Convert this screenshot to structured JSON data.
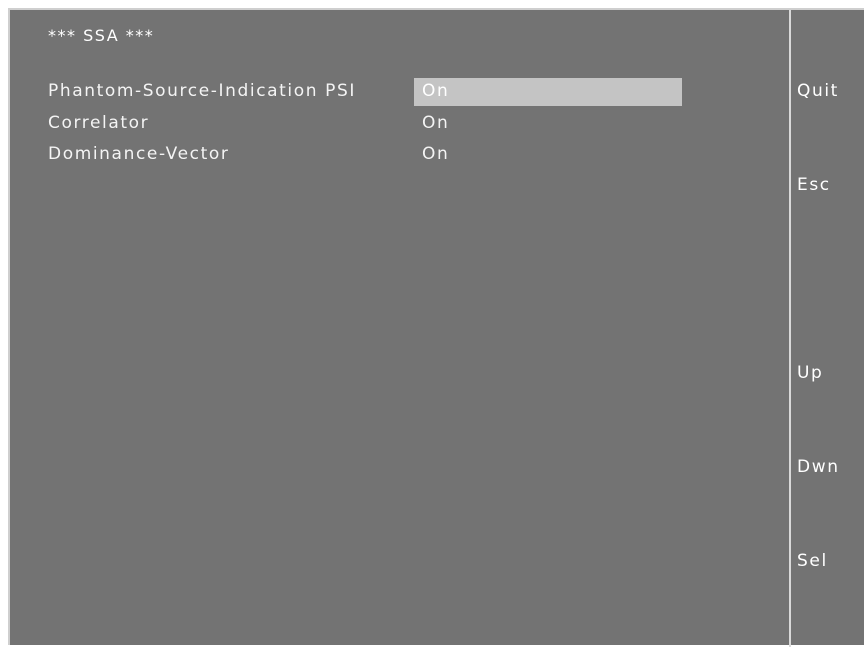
{
  "screen": {
    "title": "*** SSA ***"
  },
  "menu": {
    "items": [
      {
        "label": "Phantom-Source-Indication PSI",
        "value": "On",
        "selected": true
      },
      {
        "label": "Correlator",
        "value": "On",
        "selected": false
      },
      {
        "label": "Dominance-Vector",
        "value": "On",
        "selected": false
      }
    ]
  },
  "softkeys": {
    "quit": "Quit",
    "esc": "Esc",
    "up": "Up",
    "down": "Dwn",
    "select": "Sel"
  },
  "colors": {
    "background": "#737373",
    "selection": "#c4c4c4",
    "text": "#ffffff"
  }
}
